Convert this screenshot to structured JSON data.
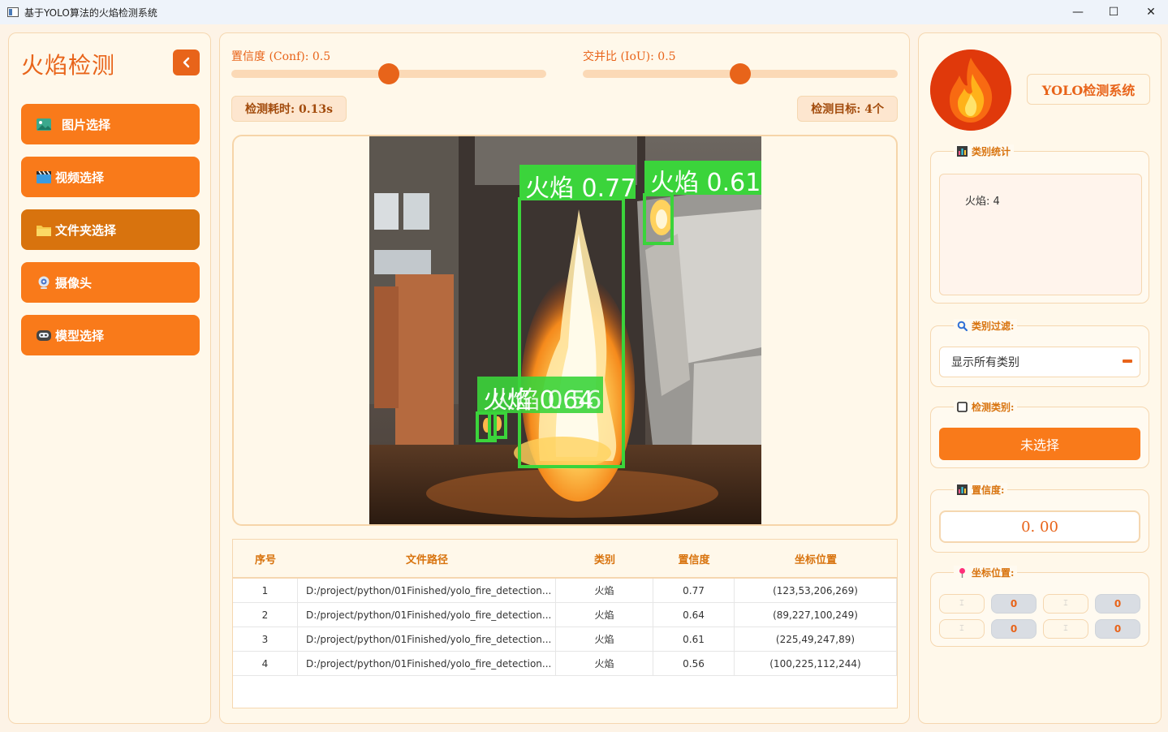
{
  "window": {
    "title": "基于YOLO算法的火焰检测系统",
    "min_glyph": "—",
    "max_glyph": "☐",
    "close_glyph": "✕"
  },
  "sidebar": {
    "heading": "火焰检测",
    "items": [
      {
        "label": "图片选择",
        "icon": "image-icon"
      },
      {
        "label": "视频选择",
        "icon": "clapperboard-icon"
      },
      {
        "label": "文件夹选择",
        "icon": "folder-icon"
      },
      {
        "label": "摄像头",
        "icon": "webcam-icon"
      },
      {
        "label": "模型选择",
        "icon": "model-icon"
      }
    ]
  },
  "controls": {
    "conf_label": "置信度 (Conf): 0.5",
    "conf_value": 0.5,
    "iou_label": "交并比 (IoU): 0.5",
    "iou_value": 0.5,
    "time_text": "检测耗时: 0.13s",
    "count_text": "检测目标: 4个"
  },
  "detections": {
    "labels": [
      "火焰 0.77",
      "火焰 0.61",
      "火焰 0.64",
      "火焰 0.56"
    ],
    "box_color": "#3bd43b"
  },
  "table": {
    "headers": [
      "序号",
      "文件路径",
      "类别",
      "置信度",
      "坐标位置"
    ],
    "rows": [
      [
        "1",
        "D:/project/python/01Finished/yolo_fire_detection...",
        "火焰",
        "0.77",
        "(123,53,206,269)"
      ],
      [
        "2",
        "D:/project/python/01Finished/yolo_fire_detection...",
        "火焰",
        "0.64",
        "(89,227,100,249)"
      ],
      [
        "3",
        "D:/project/python/01Finished/yolo_fire_detection...",
        "火焰",
        "0.61",
        "(225,49,247,89)"
      ],
      [
        "4",
        "D:/project/python/01Finished/yolo_fire_detection...",
        "火焰",
        "0.56",
        "(100,225,112,244)"
      ]
    ]
  },
  "right": {
    "system_title": "YOLO检测系统",
    "stats_title": "类别统计",
    "stats_text": "火焰: 4",
    "filter_title": "类别过滤:",
    "filter_value": "显示所有类别",
    "class_title": "检测类别:",
    "class_value": "未选择",
    "conf_title": "置信度:",
    "conf_value": "0. 00",
    "coord_title": "坐标位置:",
    "coords": {
      "xmin": "0",
      "ymin": "0",
      "xmax": "0",
      "ymax": "0"
    },
    "coord_glyph": "⌶"
  },
  "colors": {
    "accent": "#f97a1a",
    "accent_dark": "#e8641a",
    "panel_bg": "#fff8ea",
    "border": "#f5d7b0"
  }
}
